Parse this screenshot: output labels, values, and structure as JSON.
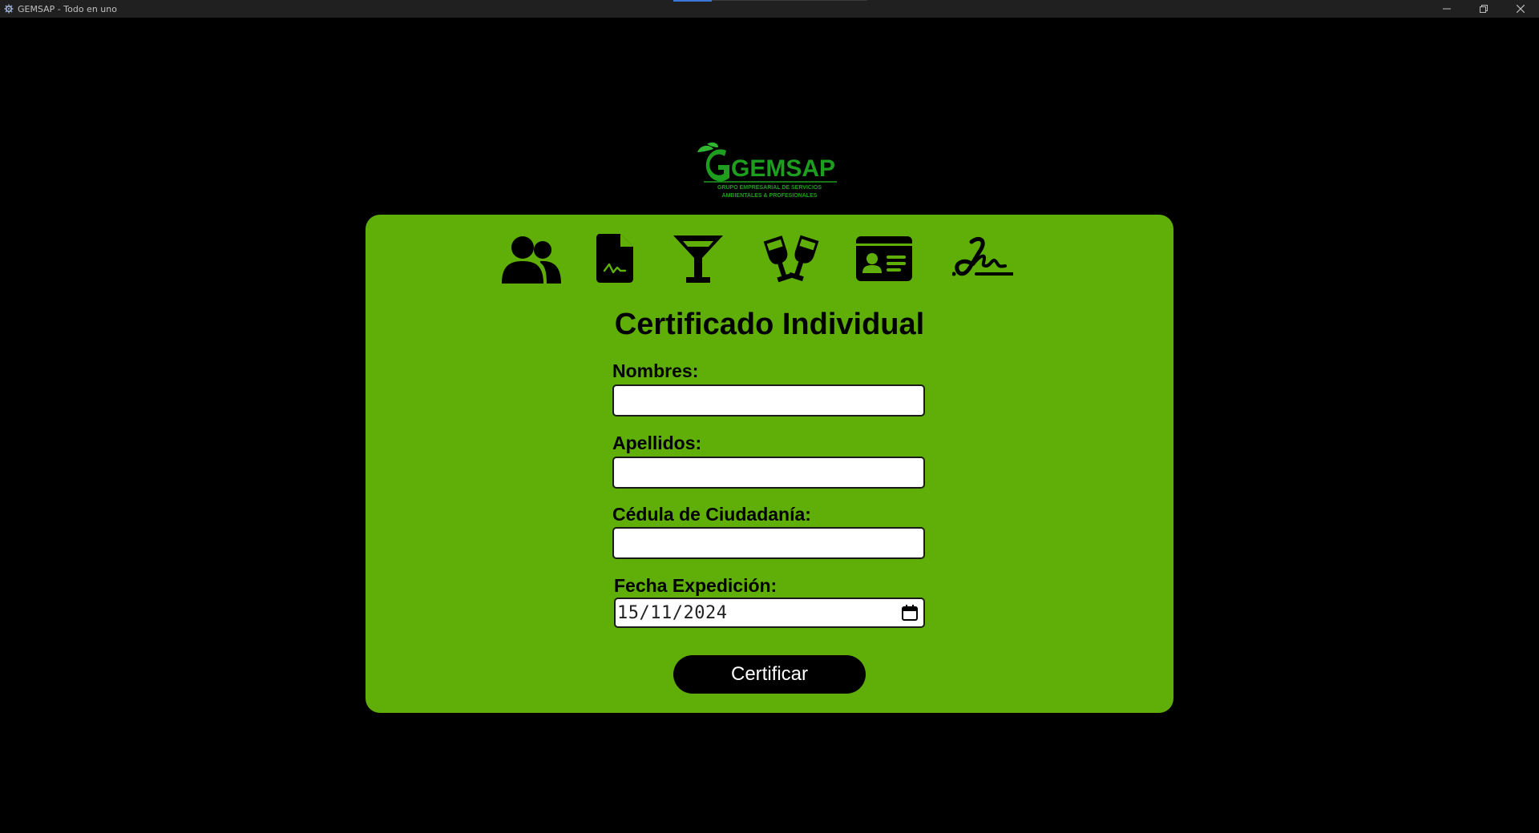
{
  "window": {
    "title": "GEMSAP - Todo en uno",
    "controls": [
      "minimize",
      "restore",
      "close"
    ]
  },
  "logo": {
    "wordmark": "GEMSAP",
    "tagline_line1": "GRUPO EMPRESARIAL DE SERVICIOS",
    "tagline_line2": "AMBIENTALES & PROFESIONALES",
    "color": "#1e9e1e"
  },
  "nav_icons": [
    "users-icon",
    "file-signature-icon",
    "cocktail-icon",
    "glass-cheers-icon",
    "id-card-icon",
    "signature-icon"
  ],
  "form": {
    "title": "Certificado Individual",
    "fields": [
      {
        "label": "Nombres:",
        "value": ""
      },
      {
        "label": "Apellidos:",
        "value": ""
      },
      {
        "label": "Cédula de Ciudadanía:",
        "value": ""
      }
    ],
    "date": {
      "label": "Fecha Expedición:",
      "value": "15/11/2024"
    },
    "submit_label": "Certificar"
  },
  "colors": {
    "background": "#000000",
    "card": "#5faf08",
    "titlebar": "#202020",
    "button": "#000000",
    "button_text": "#ffffff"
  }
}
